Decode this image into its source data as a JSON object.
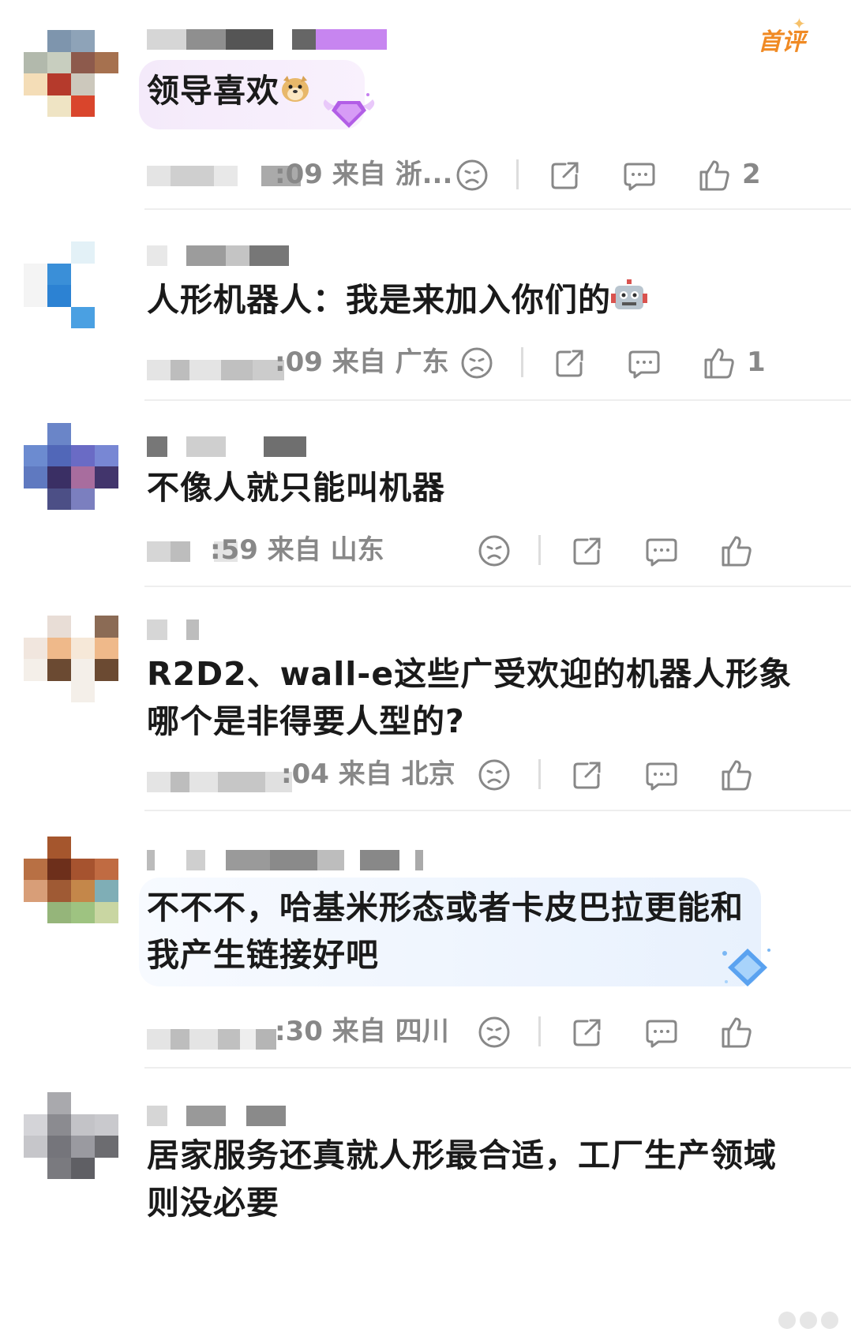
{
  "badge": {
    "first_comment": "首评"
  },
  "comments": [
    {
      "text": "领导喜欢",
      "emoji": "doge-emoji",
      "time": ":09",
      "location_prefix": "来自",
      "location": "浙...",
      "likes": "2"
    },
    {
      "text": "人形机器人：我是来加入你们的",
      "emoji": "robot-emoji",
      "time": ":09",
      "location_prefix": "来自",
      "location": "广东",
      "likes": "1"
    },
    {
      "text": "不像人就只能叫机器",
      "time": ":59",
      "location_prefix": "来自",
      "location": "山东",
      "likes": ""
    },
    {
      "text_line1": "R2D2、wall-e这些广受欢迎的机器人形象",
      "text_line2": "哪个是非得要人型的?",
      "time": ":04",
      "location_prefix": "来自",
      "location": "北京",
      "likes": ""
    },
    {
      "text_line1": "不不不，哈基米形态或者卡皮巴拉更能和",
      "text_line2": "我产生链接好吧",
      "time": ":30",
      "location_prefix": "来自",
      "location": "四川",
      "likes": ""
    },
    {
      "text_line1": "居家服务还真就人形最合适，工厂生产领域",
      "text_line2": "则没必要"
    }
  ],
  "colors": {
    "first_badge": "#f08a24",
    "bubble_purple": "#f6ecfb",
    "bubble_blue": "#eef4fd",
    "meta_gray": "#888888"
  }
}
